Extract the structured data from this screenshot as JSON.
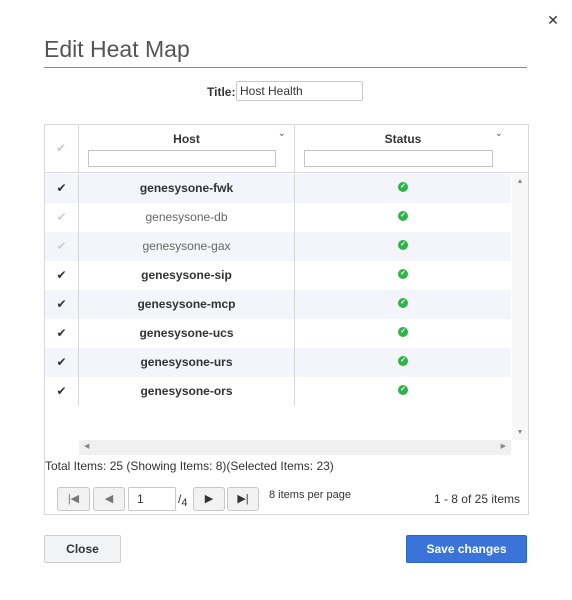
{
  "dialog": {
    "title": "Edit Heat Map",
    "close_icon": "close-icon",
    "title_field": {
      "label": "Title:",
      "value": "Host Health"
    }
  },
  "grid": {
    "columns": {
      "host": "Host",
      "status": "Status"
    },
    "rows": [
      {
        "host": "genesysone-fwk",
        "selected": true,
        "status": "ok"
      },
      {
        "host": "genesysone-db",
        "selected": false,
        "status": "ok"
      },
      {
        "host": "genesysone-gax",
        "selected": false,
        "status": "ok"
      },
      {
        "host": "genesysone-sip",
        "selected": true,
        "status": "ok"
      },
      {
        "host": "genesysone-mcp",
        "selected": true,
        "status": "ok"
      },
      {
        "host": "genesysone-ucs",
        "selected": true,
        "status": "ok"
      },
      {
        "host": "genesysone-urs",
        "selected": true,
        "status": "ok"
      },
      {
        "host": "genesysone-ors",
        "selected": true,
        "status": "ok"
      }
    ],
    "totals": "Total Items: 25 (Showing Items: 8)(Selected Items: 23)"
  },
  "pager": {
    "current_page": "1",
    "of_separator": "/",
    "total_pages": "4",
    "per_page": "8 items per page",
    "range": "1 - 8 of 25 items"
  },
  "buttons": {
    "close": "Close",
    "save": "Save changes"
  },
  "colors": {
    "accent": "#3b74d8",
    "status_ok": "#2fb34a",
    "alt_row": "#f3f5fa"
  }
}
